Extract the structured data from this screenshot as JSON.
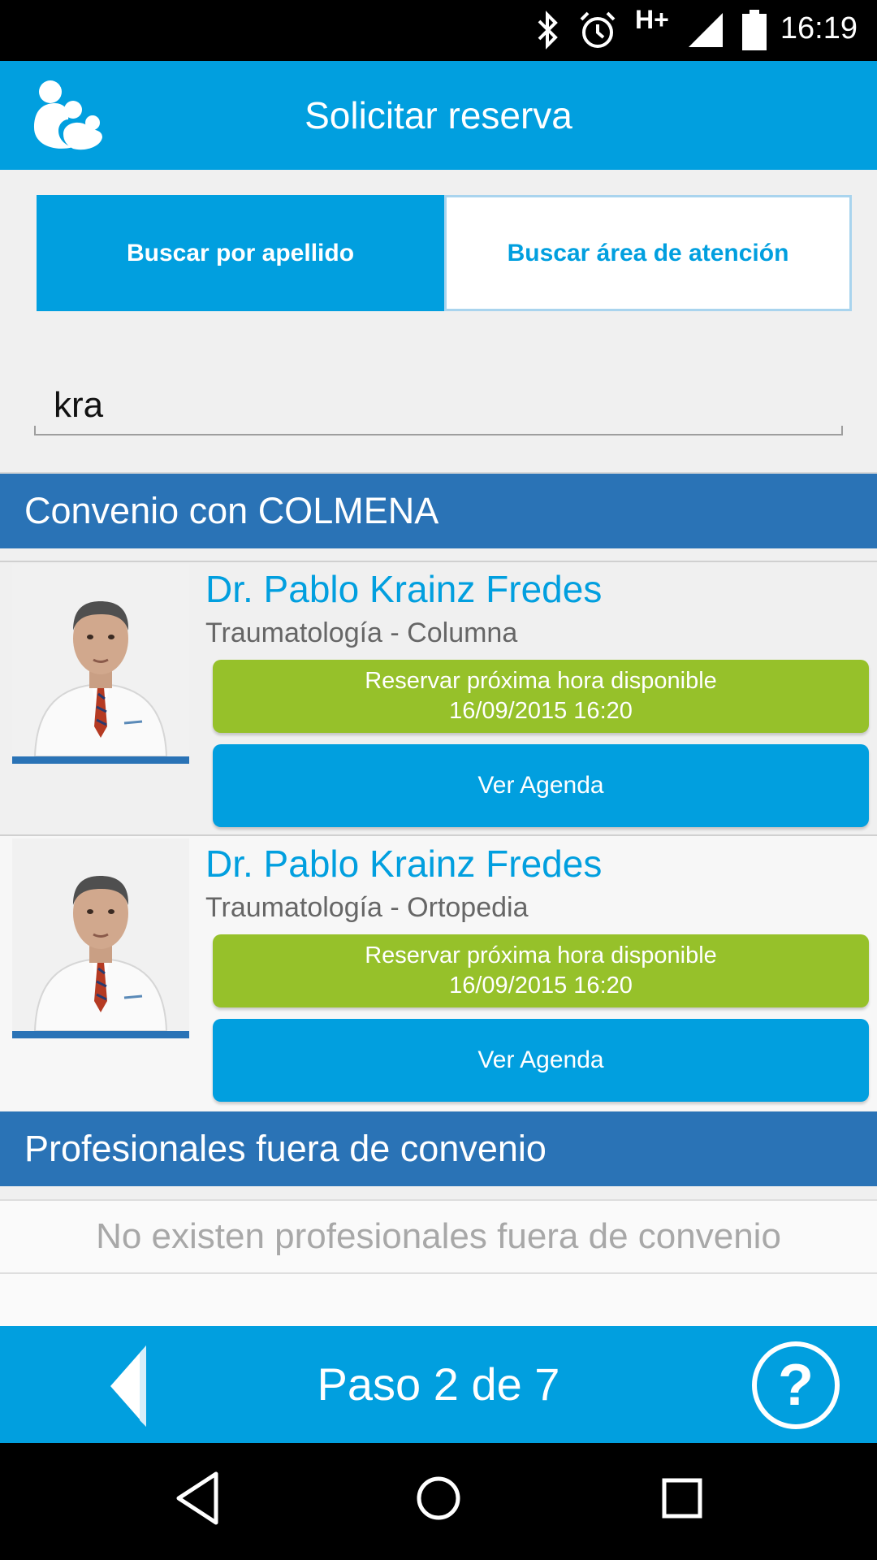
{
  "status_bar": {
    "network_label": "H+",
    "time": "16:19",
    "icons": [
      "bluetooth-icon",
      "alarm-icon",
      "signal-icon",
      "battery-icon"
    ]
  },
  "app_bar": {
    "title": "Solicitar reserva",
    "logo_icon": "family-logo-icon"
  },
  "tabs": [
    {
      "label": "Buscar por apellido",
      "selected": true
    },
    {
      "label": "Buscar área de atención",
      "selected": false
    }
  ],
  "search": {
    "value": "kra"
  },
  "sections": {
    "with_agreement": {
      "title": "Convenio con COLMENA",
      "doctors": [
        {
          "name": "Dr. Pablo Krainz Fredes",
          "specialty": "Traumatología - Columna",
          "book_label": "Reservar próxima hora disponible",
          "book_datetime": "16/09/2015 16:20",
          "agenda_label": "Ver Agenda"
        },
        {
          "name": "Dr. Pablo Krainz Fredes",
          "specialty": "Traumatología - Ortopedia",
          "book_label": "Reservar próxima hora disponible",
          "book_datetime": "16/09/2015 16:20",
          "agenda_label": "Ver Agenda"
        }
      ]
    },
    "without_agreement": {
      "title": "Profesionales fuera de convenio",
      "empty_message": "No existen profesionales fuera de convenio"
    }
  },
  "footer": {
    "step_label": "Paso 2 de 7",
    "back_icon": "back-arrow-icon",
    "help_icon": "help-icon"
  },
  "nav_bar": {
    "icons": [
      "nav-back-icon",
      "nav-home-icon",
      "nav-recents-icon"
    ]
  },
  "colors": {
    "primary": "#019fdf",
    "section_header": "#2a73b6",
    "book_button": "#96c12a",
    "name_text": "#019fdf",
    "empty_text": "#a8a8a8"
  }
}
